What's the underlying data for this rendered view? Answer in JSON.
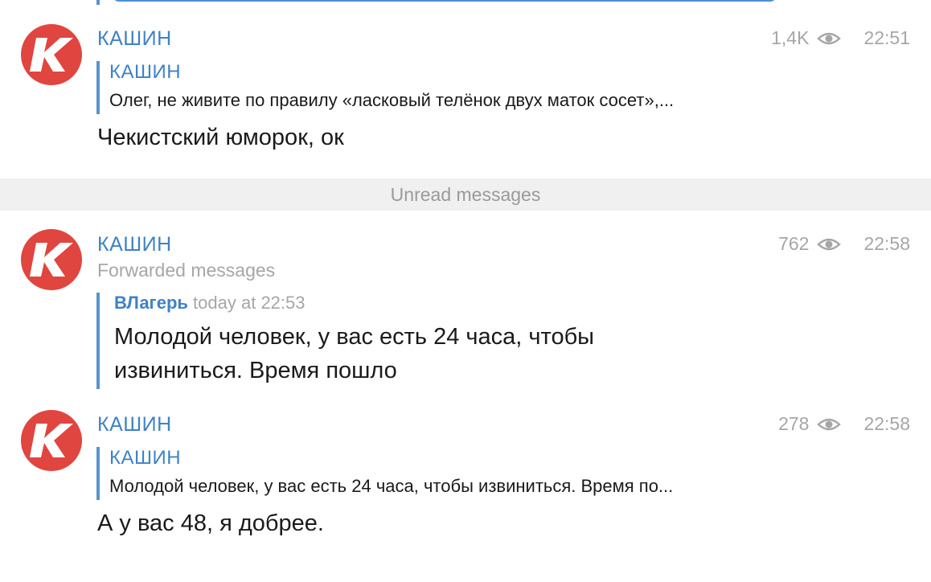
{
  "unread_label": "Unread messages",
  "messages": [
    {
      "author": "КАШИН",
      "views": "1,4K",
      "time": "22:51",
      "reply": {
        "author": "КАШИН",
        "text": "Олег, не живите по правилу «ласковый телёнок двух маток сосет»,..."
      },
      "text": "Чекистский юморок, ок"
    },
    {
      "author": "КАШИН",
      "views": "762",
      "time": "22:58",
      "forwarded_label": "Forwarded messages",
      "forwarded": {
        "author": "ВЛагерь",
        "date": "today at 22:53",
        "text": "Молодой человек, у вас есть 24 часа, чтобы извиниться. Время пошло"
      }
    },
    {
      "author": "КАШИН",
      "views": "278",
      "time": "22:58",
      "reply": {
        "author": "КАШИН",
        "text": "Молодой человек, у вас есть 24 часа, чтобы извиниться. Время по..."
      },
      "text": "А у вас 48, я добрее."
    }
  ],
  "colors": {
    "accent": "#3f82c6",
    "avatar_bg": "#e0453f",
    "muted": "#a6a6a6"
  }
}
